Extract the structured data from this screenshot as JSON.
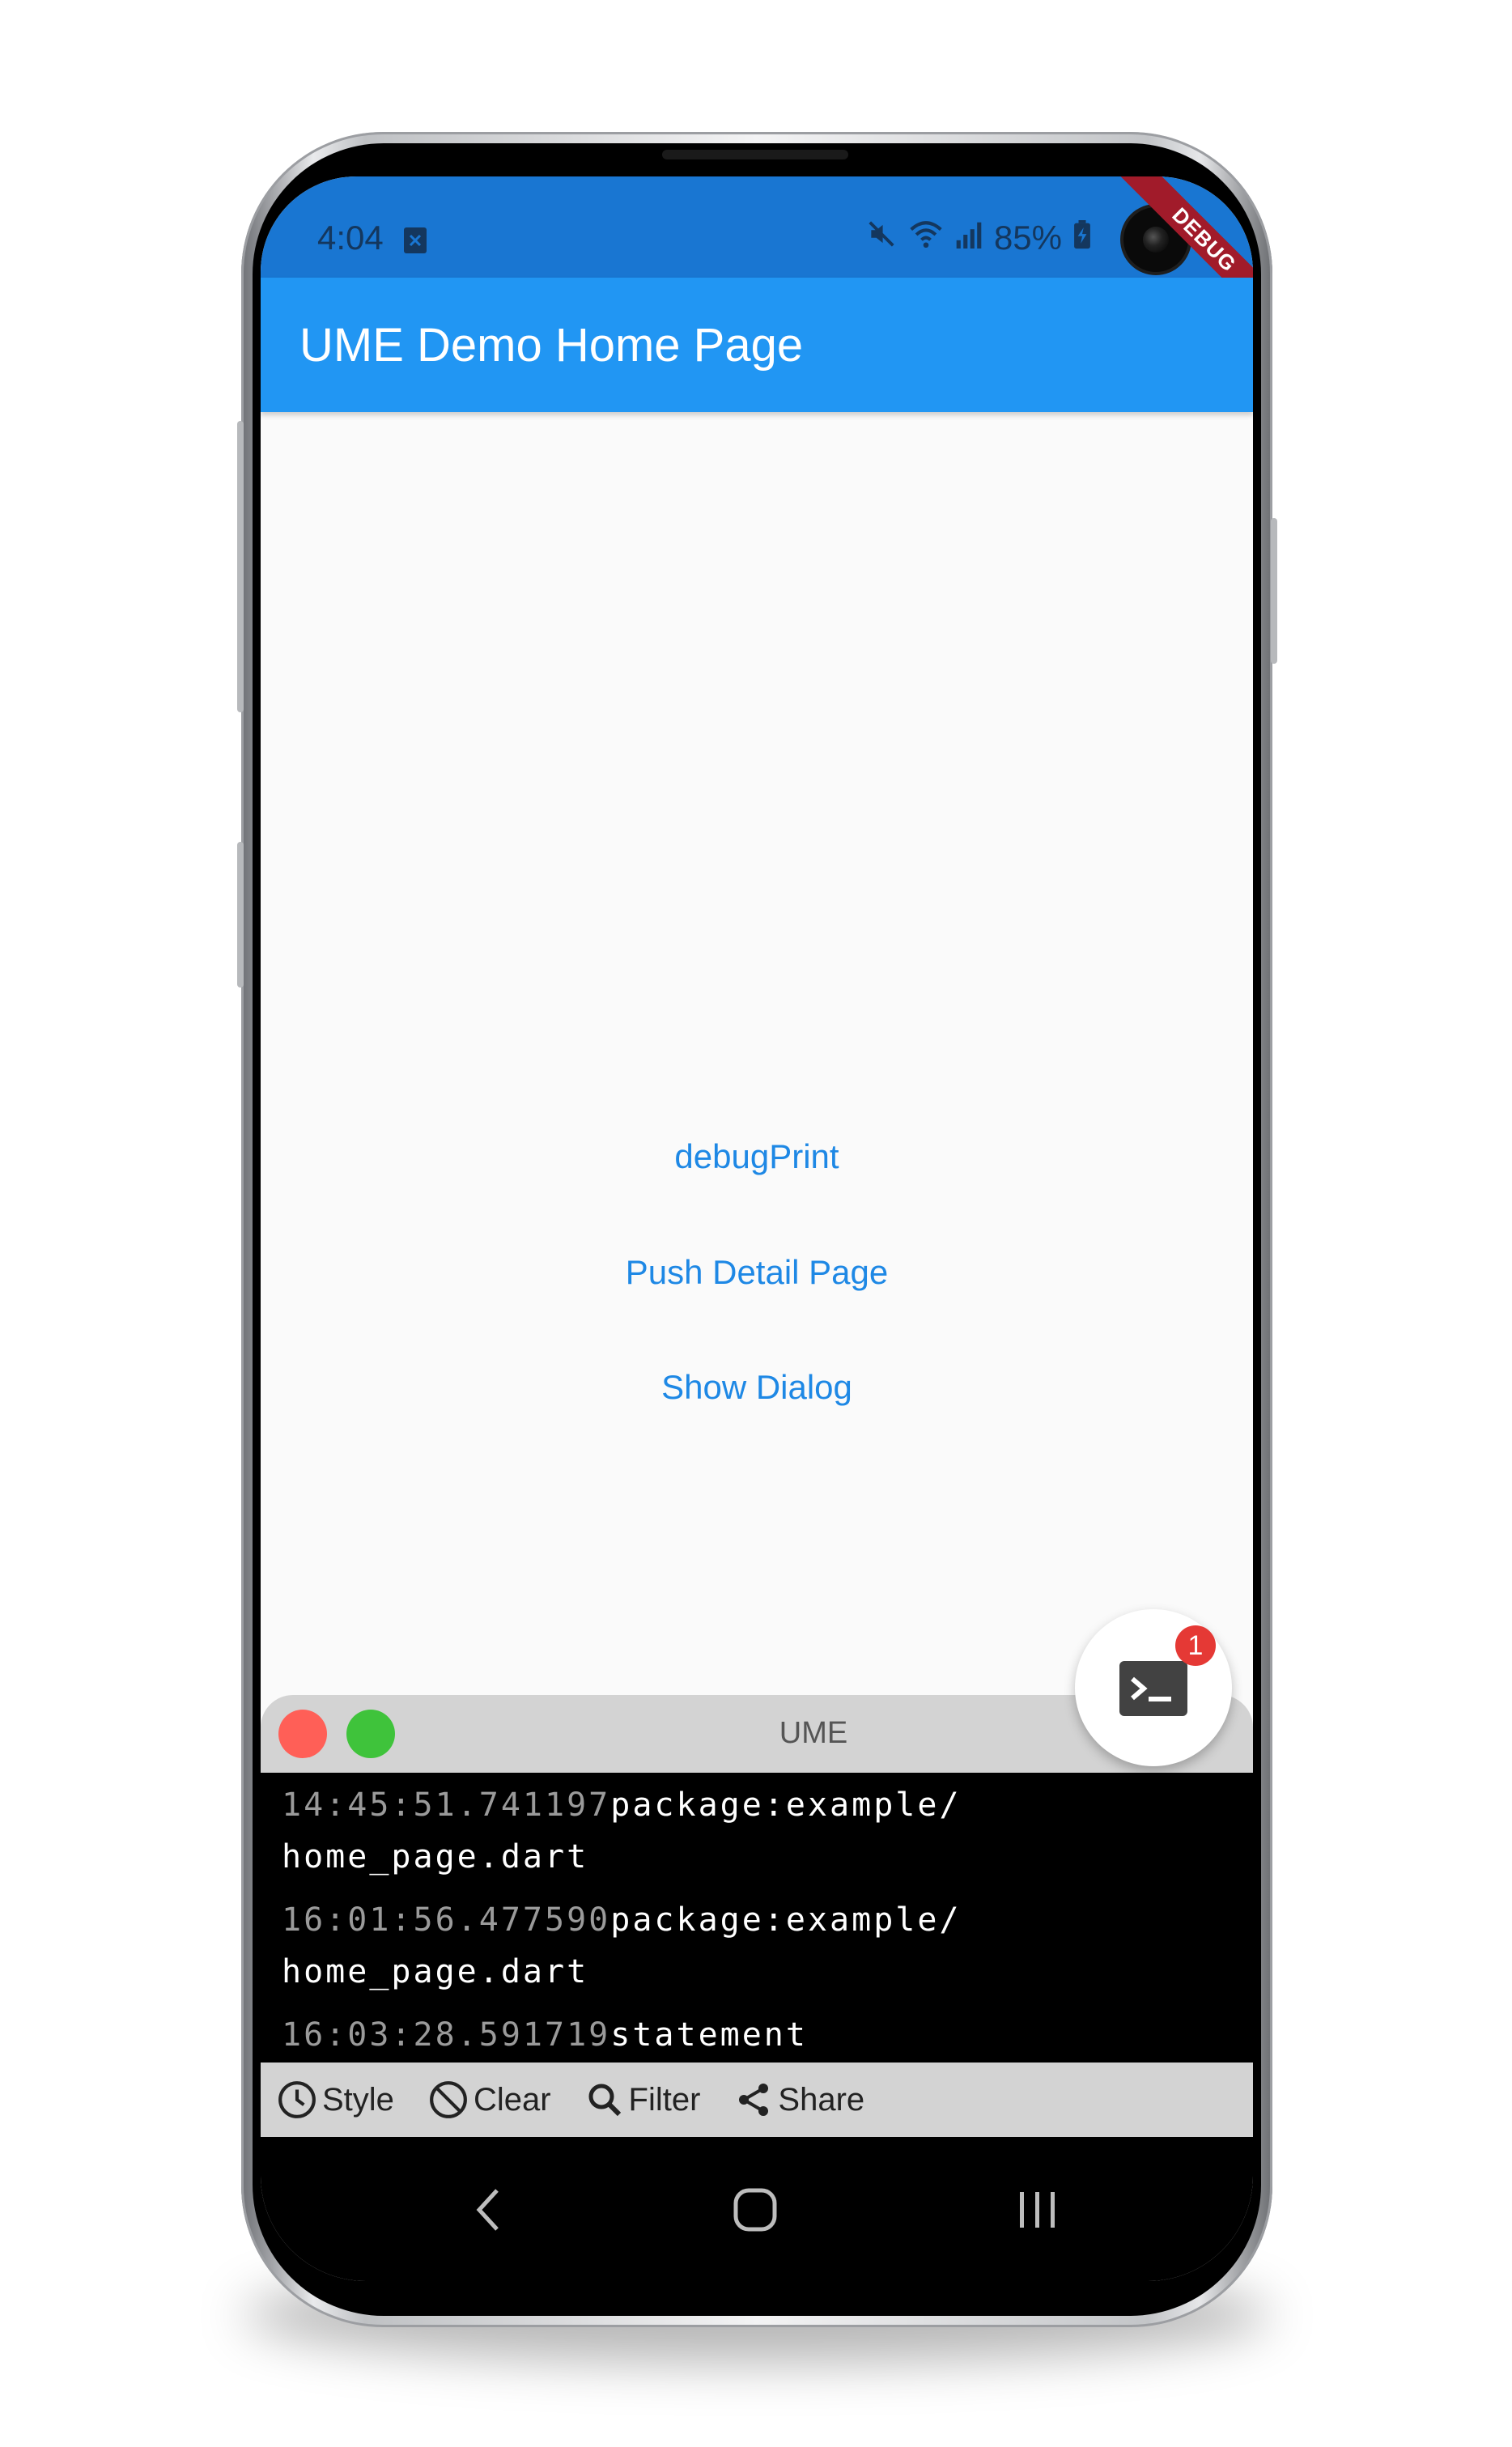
{
  "status_bar": {
    "time": "4:04",
    "battery": "85%",
    "debug_banner": "DEBUG"
  },
  "app_bar": {
    "title": "UME Demo Home Page",
    "color": "#2196f3"
  },
  "buttons": {
    "debug_print": "debugPrint",
    "push_detail": "Push Detail Page",
    "show_dialog": "Show Dialog"
  },
  "fab": {
    "icon": "terminal-icon",
    "badge_count": "1"
  },
  "console": {
    "title": "UME",
    "logs": [
      {
        "timestamp": "14:45:51.741197",
        "message": "package:example/",
        "message2": "home_page.dart"
      },
      {
        "timestamp": "16:01:56.477590",
        "message": "package:example/",
        "message2": "home_page.dart"
      },
      {
        "timestamp": "16:03:28.591719",
        "message": "statement"
      }
    ],
    "toolbar": {
      "style": "Style",
      "clear": "Clear",
      "filter": "Filter",
      "share": "Share"
    }
  },
  "colors": {
    "close_dot": "#ff5f57",
    "max_dot": "#3fc33b",
    "badge": "#e53935"
  }
}
